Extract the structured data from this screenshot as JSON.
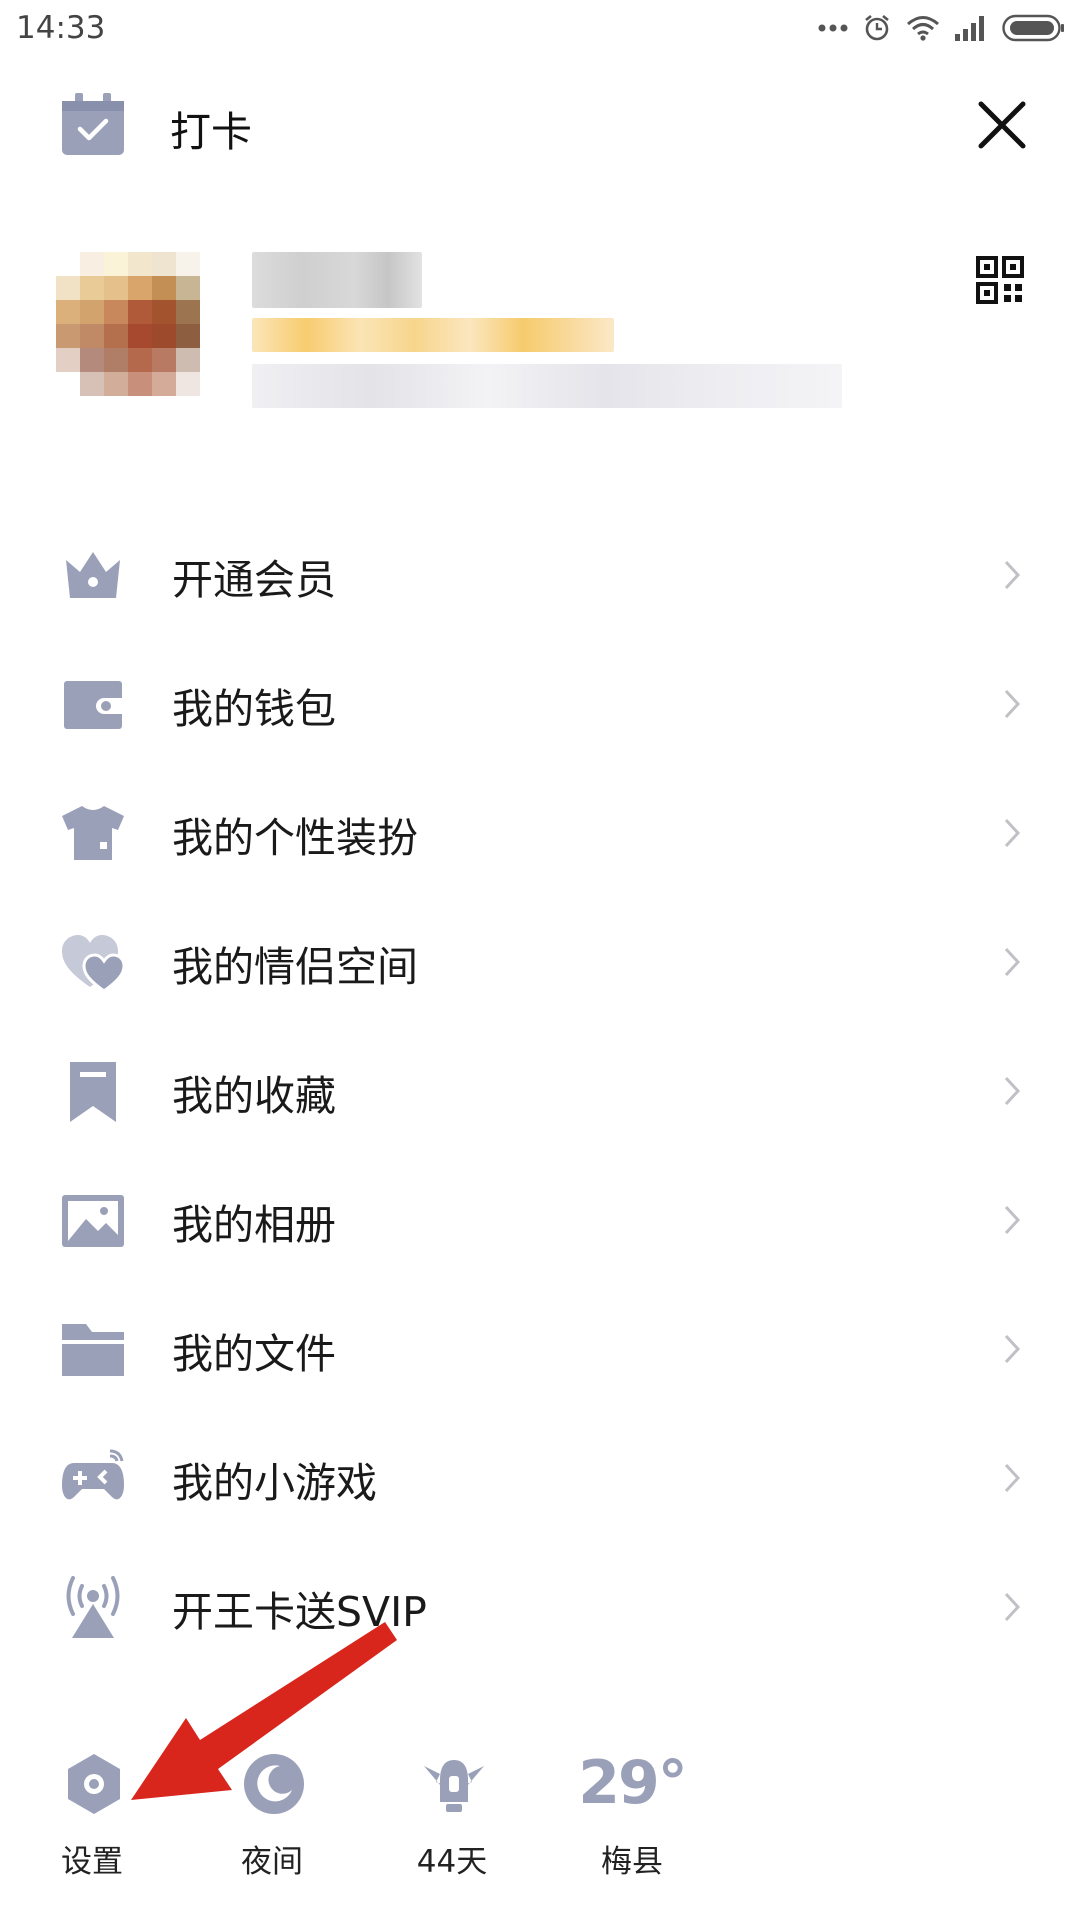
{
  "status_bar": {
    "time": "14:33"
  },
  "header": {
    "checkin_label": "打卡"
  },
  "menu": [
    {
      "label": "开通会员",
      "icon": "crown-icon"
    },
    {
      "label": "我的钱包",
      "icon": "wallet-icon"
    },
    {
      "label": "我的个性装扮",
      "icon": "tshirt-icon"
    },
    {
      "label": "我的情侣空间",
      "icon": "hearts-icon"
    },
    {
      "label": "我的收藏",
      "icon": "bookmark-icon"
    },
    {
      "label": "我的相册",
      "icon": "photo-icon"
    },
    {
      "label": "我的文件",
      "icon": "folder-icon"
    },
    {
      "label": "我的小游戏",
      "icon": "gamepad-icon"
    },
    {
      "label": "开王卡送SVIP",
      "icon": "antenna-icon"
    }
  ],
  "bottom": {
    "settings": "设置",
    "night": "夜间",
    "days": "44天",
    "weather_temp": "29°",
    "weather_city": "梅县"
  },
  "colors": {
    "icon": "#9aa0b8",
    "arrow": "#d9261c"
  }
}
